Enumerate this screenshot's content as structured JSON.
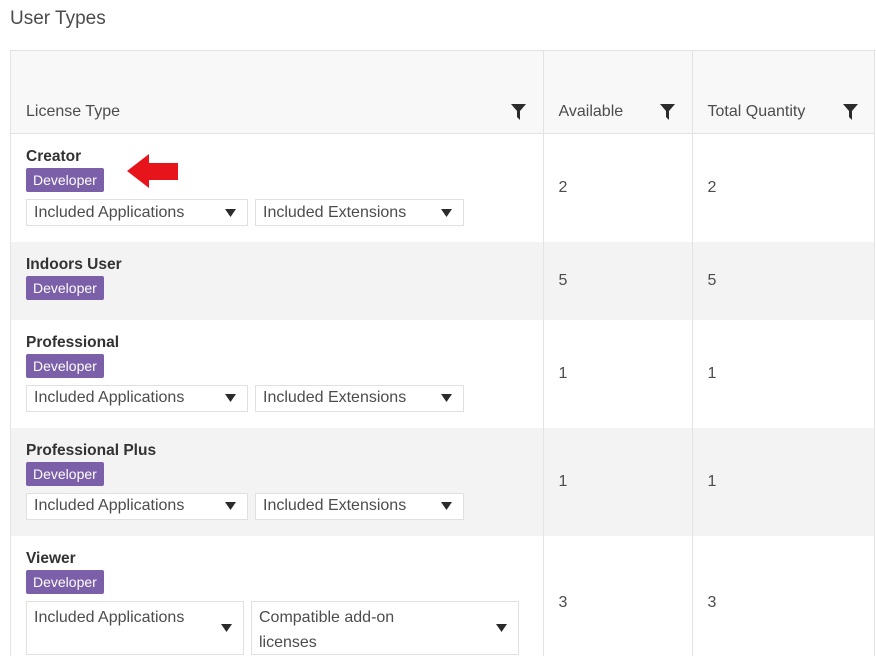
{
  "page": {
    "title": "User Types"
  },
  "table": {
    "columns": [
      "License Type",
      "Available",
      "Total Quantity"
    ],
    "rows": [
      {
        "name": "Creator",
        "badge": "Developer",
        "available": "2",
        "total": "2",
        "dropdowns": [
          "Included Applications",
          "Included Extensions"
        ]
      },
      {
        "name": "Indoors User",
        "badge": "Developer",
        "available": "5",
        "total": "5",
        "dropdowns": []
      },
      {
        "name": "Professional",
        "badge": "Developer",
        "available": "1",
        "total": "1",
        "dropdowns": [
          "Included Applications",
          "Included Extensions"
        ]
      },
      {
        "name": "Professional Plus",
        "badge": "Developer",
        "available": "1",
        "total": "1",
        "dropdowns": [
          "Included Applications",
          "Included Extensions"
        ]
      },
      {
        "name": "Viewer",
        "badge": "Developer",
        "available": "3",
        "total": "3",
        "dropdowns": [
          "Included Applications",
          "Compatible add-on licenses"
        ]
      }
    ]
  },
  "icons": {
    "filter": "filter-icon",
    "caret": "caret-down-icon",
    "annotation": "red-arrow-icon"
  },
  "colors": {
    "badge": "#7b5fa8",
    "arrow": "#e8141c",
    "alt_row": "#f3f3f3",
    "header_bg": "#f8f8f8"
  }
}
